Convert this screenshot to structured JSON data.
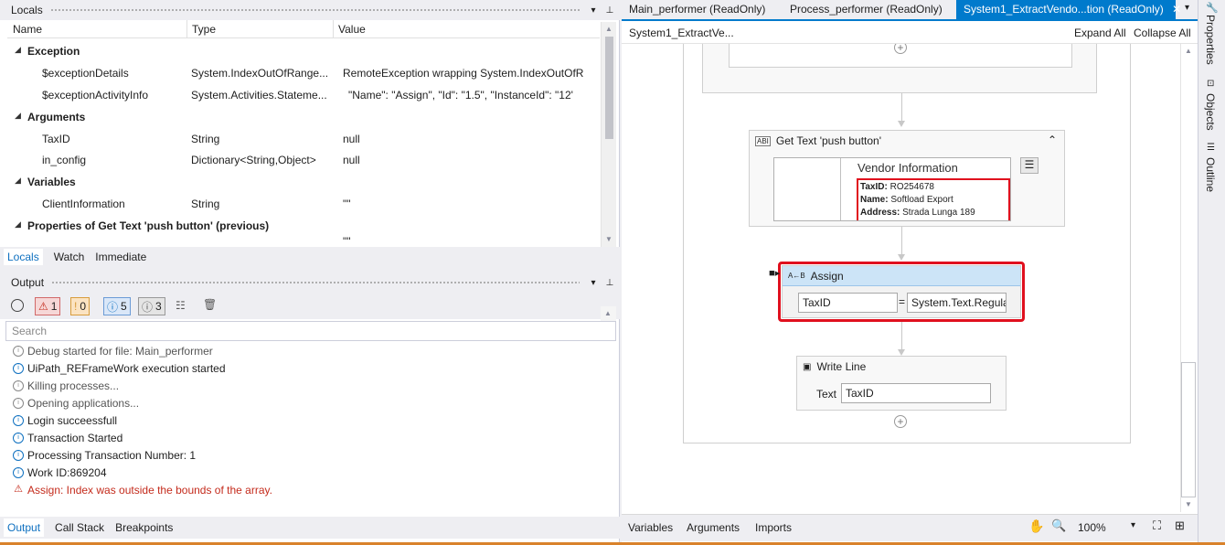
{
  "locals": {
    "title": "Locals",
    "columns": [
      "Name",
      "Type",
      "Value"
    ],
    "groups": {
      "exception": "Exception",
      "arguments": "Arguments",
      "variables": "Variables",
      "properties": "Properties of Get Text 'push button' (previous)"
    },
    "rows": [
      {
        "name": "$exceptionDetails",
        "type": "System.IndexOutOfRange...",
        "value": "RemoteException wrapping System.IndexOutOfR"
      },
      {
        "name": "$exceptionActivityInfo",
        "type": "System.Activities.Stateme...",
        "value": "\"Name\": \"Assign\",  \"Id\": \"1.5\",  \"InstanceId\": \"12'"
      },
      {
        "name": "TaxID",
        "type": "String",
        "value": "null"
      },
      {
        "name": "in_config",
        "type": "Dictionary<String,Object>",
        "value": "null"
      },
      {
        "name": "ClientInformation",
        "type": "String",
        "value": "\"\""
      }
    ],
    "partial_value": "\"\"",
    "tabs": [
      "Locals",
      "Watch",
      "Immediate"
    ]
  },
  "output": {
    "title": "Output",
    "counts": {
      "errors": "1",
      "warnings": "0",
      "info": "5",
      "trace": "3"
    },
    "search_placeholder": "Search",
    "lines": [
      {
        "text": "Debug started for file: Main_performer",
        "level": "trace"
      },
      {
        "text": "UiPath_REFrameWork execution started",
        "level": "info"
      },
      {
        "text": "Killing processes...",
        "level": "trace"
      },
      {
        "text": "Opening applications...",
        "level": "trace"
      },
      {
        "text": "Login succeessfull",
        "level": "info"
      },
      {
        "text": "Transaction Started",
        "level": "info"
      },
      {
        "text": "Processing Transaction Number: 1",
        "level": "info"
      },
      {
        "text": "Work ID:869204",
        "level": "info"
      },
      {
        "text": "Assign: Index was outside the bounds of the array.",
        "level": "error"
      }
    ],
    "tabs": [
      "Output",
      "Call Stack",
      "Breakpoints"
    ]
  },
  "designer": {
    "tabs": [
      "Main_performer (ReadOnly)",
      "Process_performer (ReadOnly)",
      "System1_ExtractVendo...tion (ReadOnly)"
    ],
    "breadcrumb": "System1_ExtractVe...",
    "expand_all": "Expand All",
    "collapse_all": "Collapse All",
    "get_text": {
      "title": "Get Text 'push button'",
      "preview_heading": "Vendor Information",
      "preview_lines": [
        {
          "label": "TaxID:",
          "value": "RO254678"
        },
        {
          "label": "Name:",
          "value": "Softload Export"
        },
        {
          "label": "Address:",
          "value": "Strada Lunga 189"
        }
      ]
    },
    "assign": {
      "title": "Assign",
      "to": "TaxID",
      "equals": "=",
      "value": "System.Text.Regula"
    },
    "write_line": {
      "title": "Write Line",
      "text_label": "Text",
      "text_value": "TaxID"
    },
    "bottom": {
      "tabs": [
        "Variables",
        "Arguments",
        "Imports"
      ],
      "zoom": "100%"
    }
  },
  "sidebar": {
    "tabs": [
      "Properties",
      "Objects",
      "Outline"
    ]
  },
  "colors": {
    "accent": "#007acc",
    "highlight_border": "#e0101e",
    "error_text": "#c42b1c",
    "status_bar": "#d9822b"
  }
}
